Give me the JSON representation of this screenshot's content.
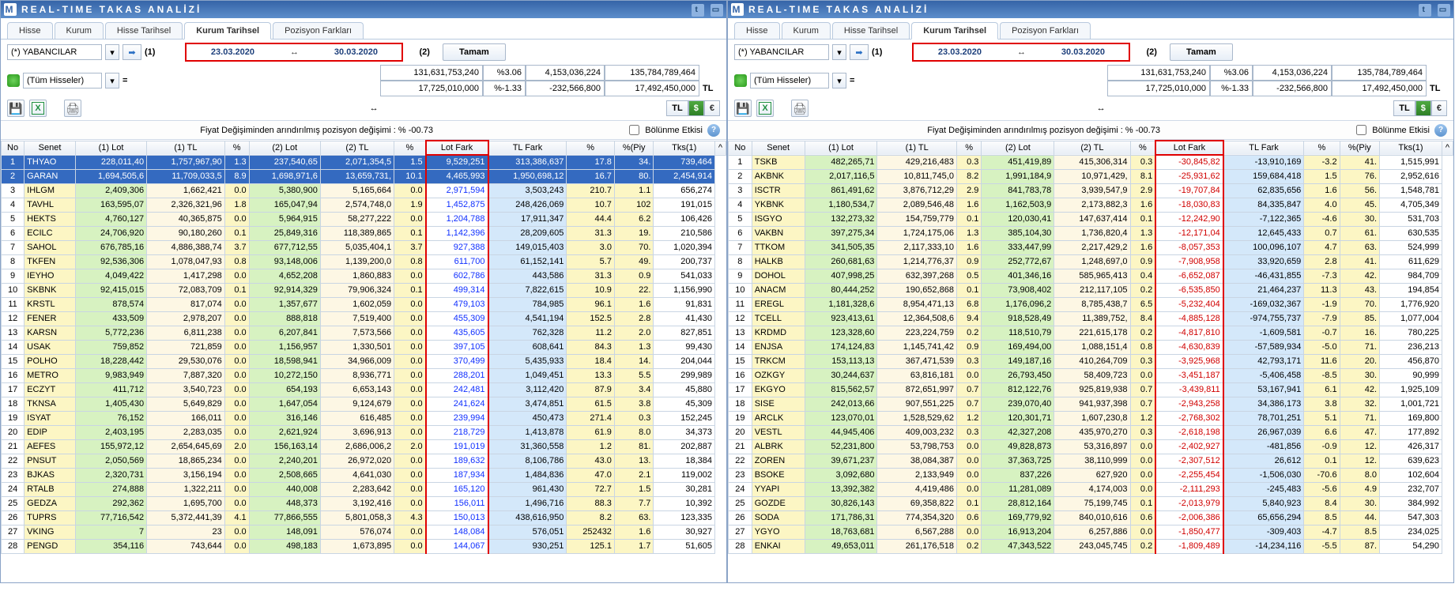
{
  "title": "REAL-TIME TAKAS ANALİZİ",
  "tabs": {
    "t0": "Hisse",
    "t1": "Kurum",
    "t2": "Hisse Tarihsel",
    "t3": "Kurum Tarihsel",
    "t4": "Pozisyon Farkları"
  },
  "filter": {
    "name": "(*) YABANCILAR",
    "all": "(Tüm Hisseler)",
    "l1": "(1)",
    "l2": "(2)",
    "tamam": "Tamam"
  },
  "dates": {
    "from": "23.03.2020",
    "to": "30.03.2020"
  },
  "summary": {
    "r1c1": "131,631,753,240",
    "r1c2": "%3.06",
    "r1c3": "4,153,036,224",
    "r1c4": "135,784,789,464",
    "r2c1": "17,725,010,000",
    "r2c2": "%-1.33",
    "r2c3": "-232,566,800",
    "r2c4": "17,492,450,000",
    "r2c5": "TL"
  },
  "tl": "TL",
  "usd": "$",
  "eur": "€",
  "arrow": "↔",
  "info": "Fiyat Değişiminden arındırılmış pozisyon değişimi : % -00.73",
  "chk": "Bölünme Etkisi",
  "hdr": {
    "no": "No",
    "senet": "Senet",
    "lot1": "(1) Lot",
    "tl1": "(1) TL",
    "p1": "%",
    "lot2": "(2) Lot",
    "tl2": "(2) TL",
    "p2": "%",
    "lotfark": "Lot Fark",
    "tlfark": "TL Fark",
    "p3": "%",
    "piy": "%(Piy",
    "tks": "Tks(1)"
  },
  "left": {
    "rows": [
      {
        "no": 1,
        "s": "THYAO",
        "l1": "228,011,40",
        "t1": "1,757,967,90",
        "p1": "1.3",
        "l2": "237,540,65",
        "t2": "2,071,354,5",
        "p2": "1.5",
        "lf": "9,529,251",
        "tf": "313,386,637",
        "p3": "17.8",
        "py": "34.",
        "tk": "739,464"
      },
      {
        "no": 2,
        "s": "GARAN",
        "l1": "1,694,505,6",
        "t1": "11,709,033,5",
        "p1": "8.9",
        "l2": "1,698,971,6",
        "t2": "13,659,731,",
        "p2": "10.1",
        "lf": "4,465,993",
        "tf": "1,950,698,12",
        "p3": "16.7",
        "py": "80.",
        "tk": "2,454,914"
      },
      {
        "no": 3,
        "s": "IHLGM",
        "l1": "2,409,306",
        "t1": "1,662,421",
        "p1": "0.0",
        "l2": "5,380,900",
        "t2": "5,165,664",
        "p2": "0.0",
        "lf": "2,971,594",
        "tf": "3,503,243",
        "p3": "210.7",
        "py": "1.1",
        "tk": "656,274"
      },
      {
        "no": 4,
        "s": "TAVHL",
        "l1": "163,595,07",
        "t1": "2,326,321,96",
        "p1": "1.8",
        "l2": "165,047,94",
        "t2": "2,574,748,0",
        "p2": "1.9",
        "lf": "1,452,875",
        "tf": "248,426,069",
        "p3": "10.7",
        "py": "102",
        "tk": "191,015"
      },
      {
        "no": 5,
        "s": "HEKTS",
        "l1": "4,760,127",
        "t1": "40,365,875",
        "p1": "0.0",
        "l2": "5,964,915",
        "t2": "58,277,222",
        "p2": "0.0",
        "lf": "1,204,788",
        "tf": "17,911,347",
        "p3": "44.4",
        "py": "6.2",
        "tk": "106,426"
      },
      {
        "no": 6,
        "s": "ECILC",
        "l1": "24,706,920",
        "t1": "90,180,260",
        "p1": "0.1",
        "l2": "25,849,316",
        "t2": "118,389,865",
        "p2": "0.1",
        "lf": "1,142,396",
        "tf": "28,209,605",
        "p3": "31.3",
        "py": "19.",
        "tk": "210,586"
      },
      {
        "no": 7,
        "s": "SAHOL",
        "l1": "676,785,16",
        "t1": "4,886,388,74",
        "p1": "3.7",
        "l2": "677,712,55",
        "t2": "5,035,404,1",
        "p2": "3.7",
        "lf": "927,388",
        "tf": "149,015,403",
        "p3": "3.0",
        "py": "70.",
        "tk": "1,020,394"
      },
      {
        "no": 8,
        "s": "TKFEN",
        "l1": "92,536,306",
        "t1": "1,078,047,93",
        "p1": "0.8",
        "l2": "93,148,006",
        "t2": "1,139,200,0",
        "p2": "0.8",
        "lf": "611,700",
        "tf": "61,152,141",
        "p3": "5.7",
        "py": "49.",
        "tk": "200,737"
      },
      {
        "no": 9,
        "s": "IEYHO",
        "l1": "4,049,422",
        "t1": "1,417,298",
        "p1": "0.0",
        "l2": "4,652,208",
        "t2": "1,860,883",
        "p2": "0.0",
        "lf": "602,786",
        "tf": "443,586",
        "p3": "31.3",
        "py": "0.9",
        "tk": "541,033"
      },
      {
        "no": 10,
        "s": "SKBNK",
        "l1": "92,415,015",
        "t1": "72,083,709",
        "p1": "0.1",
        "l2": "92,914,329",
        "t2": "79,906,324",
        "p2": "0.1",
        "lf": "499,314",
        "tf": "7,822,615",
        "p3": "10.9",
        "py": "22.",
        "tk": "1,156,990"
      },
      {
        "no": 11,
        "s": "KRSTL",
        "l1": "878,574",
        "t1": "817,074",
        "p1": "0.0",
        "l2": "1,357,677",
        "t2": "1,602,059",
        "p2": "0.0",
        "lf": "479,103",
        "tf": "784,985",
        "p3": "96.1",
        "py": "1.6",
        "tk": "91,831"
      },
      {
        "no": 12,
        "s": "FENER",
        "l1": "433,509",
        "t1": "2,978,207",
        "p1": "0.0",
        "l2": "888,818",
        "t2": "7,519,400",
        "p2": "0.0",
        "lf": "455,309",
        "tf": "4,541,194",
        "p3": "152.5",
        "py": "2.8",
        "tk": "41,430"
      },
      {
        "no": 13,
        "s": "KARSN",
        "l1": "5,772,236",
        "t1": "6,811,238",
        "p1": "0.0",
        "l2": "6,207,841",
        "t2": "7,573,566",
        "p2": "0.0",
        "lf": "435,605",
        "tf": "762,328",
        "p3": "11.2",
        "py": "2.0",
        "tk": "827,851"
      },
      {
        "no": 14,
        "s": "USAK",
        "l1": "759,852",
        "t1": "721,859",
        "p1": "0.0",
        "l2": "1,156,957",
        "t2": "1,330,501",
        "p2": "0.0",
        "lf": "397,105",
        "tf": "608,641",
        "p3": "84.3",
        "py": "1.3",
        "tk": "99,430"
      },
      {
        "no": 15,
        "s": "POLHO",
        "l1": "18,228,442",
        "t1": "29,530,076",
        "p1": "0.0",
        "l2": "18,598,941",
        "t2": "34,966,009",
        "p2": "0.0",
        "lf": "370,499",
        "tf": "5,435,933",
        "p3": "18.4",
        "py": "14.",
        "tk": "204,044"
      },
      {
        "no": 16,
        "s": "METRO",
        "l1": "9,983,949",
        "t1": "7,887,320",
        "p1": "0.0",
        "l2": "10,272,150",
        "t2": "8,936,771",
        "p2": "0.0",
        "lf": "288,201",
        "tf": "1,049,451",
        "p3": "13.3",
        "py": "5.5",
        "tk": "299,989"
      },
      {
        "no": 17,
        "s": "ECZYT",
        "l1": "411,712",
        "t1": "3,540,723",
        "p1": "0.0",
        "l2": "654,193",
        "t2": "6,653,143",
        "p2": "0.0",
        "lf": "242,481",
        "tf": "3,112,420",
        "p3": "87.9",
        "py": "3.4",
        "tk": "45,880"
      },
      {
        "no": 18,
        "s": "TKNSA",
        "l1": "1,405,430",
        "t1": "5,649,829",
        "p1": "0.0",
        "l2": "1,647,054",
        "t2": "9,124,679",
        "p2": "0.0",
        "lf": "241,624",
        "tf": "3,474,851",
        "p3": "61.5",
        "py": "3.8",
        "tk": "45,309"
      },
      {
        "no": 19,
        "s": "ISYAT",
        "l1": "76,152",
        "t1": "166,011",
        "p1": "0.0",
        "l2": "316,146",
        "t2": "616,485",
        "p2": "0.0",
        "lf": "239,994",
        "tf": "450,473",
        "p3": "271.4",
        "py": "0.3",
        "tk": "152,245"
      },
      {
        "no": 20,
        "s": "EDIP",
        "l1": "2,403,195",
        "t1": "2,283,035",
        "p1": "0.0",
        "l2": "2,621,924",
        "t2": "3,696,913",
        "p2": "0.0",
        "lf": "218,729",
        "tf": "1,413,878",
        "p3": "61.9",
        "py": "8.0",
        "tk": "34,373"
      },
      {
        "no": 21,
        "s": "AEFES",
        "l1": "155,972,12",
        "t1": "2,654,645,69",
        "p1": "2.0",
        "l2": "156,163,14",
        "t2": "2,686,006,2",
        "p2": "2.0",
        "lf": "191,019",
        "tf": "31,360,558",
        "p3": "1.2",
        "py": "81.",
        "tk": "202,887"
      },
      {
        "no": 22,
        "s": "PNSUT",
        "l1": "2,050,569",
        "t1": "18,865,234",
        "p1": "0.0",
        "l2": "2,240,201",
        "t2": "26,972,020",
        "p2": "0.0",
        "lf": "189,632",
        "tf": "8,106,786",
        "p3": "43.0",
        "py": "13.",
        "tk": "18,384"
      },
      {
        "no": 23,
        "s": "BJKAS",
        "l1": "2,320,731",
        "t1": "3,156,194",
        "p1": "0.0",
        "l2": "2,508,665",
        "t2": "4,641,030",
        "p2": "0.0",
        "lf": "187,934",
        "tf": "1,484,836",
        "p3": "47.0",
        "py": "2.1",
        "tk": "119,002"
      },
      {
        "no": 24,
        "s": "RTALB",
        "l1": "274,888",
        "t1": "1,322,211",
        "p1": "0.0",
        "l2": "440,008",
        "t2": "2,283,642",
        "p2": "0.0",
        "lf": "165,120",
        "tf": "961,430",
        "p3": "72.7",
        "py": "1.5",
        "tk": "30,281"
      },
      {
        "no": 25,
        "s": "GEDZA",
        "l1": "292,362",
        "t1": "1,695,700",
        "p1": "0.0",
        "l2": "448,373",
        "t2": "3,192,416",
        "p2": "0.0",
        "lf": "156,011",
        "tf": "1,496,716",
        "p3": "88.3",
        "py": "7.7",
        "tk": "10,392"
      },
      {
        "no": 26,
        "s": "TUPRS",
        "l1": "77,716,542",
        "t1": "5,372,441,39",
        "p1": "4.1",
        "l2": "77,866,555",
        "t2": "5,801,058,3",
        "p2": "4.3",
        "lf": "150,013",
        "tf": "438,616,950",
        "p3": "8.2",
        "py": "63.",
        "tk": "123,335"
      },
      {
        "no": 27,
        "s": "VKING",
        "l1": "7",
        "t1": "23",
        "p1": "0.0",
        "l2": "148,091",
        "t2": "576,074",
        "p2": "0.0",
        "lf": "148,084",
        "tf": "576,051",
        "p3": "252432",
        "py": "1.6",
        "tk": "30,927"
      },
      {
        "no": 28,
        "s": "PENGD",
        "l1": "354,116",
        "t1": "743,644",
        "p1": "0.0",
        "l2": "498,183",
        "t2": "1,673,895",
        "p2": "0.0",
        "lf": "144,067",
        "tf": "930,251",
        "p3": "125.1",
        "py": "1.7",
        "tk": "51,605"
      }
    ]
  },
  "right": {
    "rows": [
      {
        "no": 1,
        "s": "TSKB",
        "l1": "482,265,71",
        "t1": "429,216,483",
        "p1": "0.3",
        "l2": "451,419,89",
        "t2": "415,306,314",
        "p2": "0.3",
        "lf": "-30,845,82",
        "tf": "-13,910,169",
        "p3": "-3.2",
        "py": "41.",
        "tk": "1,515,991"
      },
      {
        "no": 2,
        "s": "AKBNK",
        "l1": "2,017,116,5",
        "t1": "10,811,745,0",
        "p1": "8.2",
        "l2": "1,991,184,9",
        "t2": "10,971,429,",
        "p2": "8.1",
        "lf": "-25,931,62",
        "tf": "159,684,418",
        "p3": "1.5",
        "py": "76.",
        "tk": "2,952,616"
      },
      {
        "no": 3,
        "s": "ISCTR",
        "l1": "861,491,62",
        "t1": "3,876,712,29",
        "p1": "2.9",
        "l2": "841,783,78",
        "t2": "3,939,547,9",
        "p2": "2.9",
        "lf": "-19,707,84",
        "tf": "62,835,656",
        "p3": "1.6",
        "py": "56.",
        "tk": "1,548,781"
      },
      {
        "no": 4,
        "s": "YKBNK",
        "l1": "1,180,534,7",
        "t1": "2,089,546,48",
        "p1": "1.6",
        "l2": "1,162,503,9",
        "t2": "2,173,882,3",
        "p2": "1.6",
        "lf": "-18,030,83",
        "tf": "84,335,847",
        "p3": "4.0",
        "py": "45.",
        "tk": "4,705,349"
      },
      {
        "no": 5,
        "s": "ISGYO",
        "l1": "132,273,32",
        "t1": "154,759,779",
        "p1": "0.1",
        "l2": "120,030,41",
        "t2": "147,637,414",
        "p2": "0.1",
        "lf": "-12,242,90",
        "tf": "-7,122,365",
        "p3": "-4.6",
        "py": "30.",
        "tk": "531,703"
      },
      {
        "no": 6,
        "s": "VAKBN",
        "l1": "397,275,34",
        "t1": "1,724,175,06",
        "p1": "1.3",
        "l2": "385,104,30",
        "t2": "1,736,820,4",
        "p2": "1.3",
        "lf": "-12,171,04",
        "tf": "12,645,433",
        "p3": "0.7",
        "py": "61.",
        "tk": "630,535"
      },
      {
        "no": 7,
        "s": "TTKOM",
        "l1": "341,505,35",
        "t1": "2,117,333,10",
        "p1": "1.6",
        "l2": "333,447,99",
        "t2": "2,217,429,2",
        "p2": "1.6",
        "lf": "-8,057,353",
        "tf": "100,096,107",
        "p3": "4.7",
        "py": "63.",
        "tk": "524,999"
      },
      {
        "no": 8,
        "s": "HALKB",
        "l1": "260,681,63",
        "t1": "1,214,776,37",
        "p1": "0.9",
        "l2": "252,772,67",
        "t2": "1,248,697,0",
        "p2": "0.9",
        "lf": "-7,908,958",
        "tf": "33,920,659",
        "p3": "2.8",
        "py": "41.",
        "tk": "611,629"
      },
      {
        "no": 9,
        "s": "DOHOL",
        "l1": "407,998,25",
        "t1": "632,397,268",
        "p1": "0.5",
        "l2": "401,346,16",
        "t2": "585,965,413",
        "p2": "0.4",
        "lf": "-6,652,087",
        "tf": "-46,431,855",
        "p3": "-7.3",
        "py": "42.",
        "tk": "984,709"
      },
      {
        "no": 10,
        "s": "ANACM",
        "l1": "80,444,252",
        "t1": "190,652,868",
        "p1": "0.1",
        "l2": "73,908,402",
        "t2": "212,117,105",
        "p2": "0.2",
        "lf": "-6,535,850",
        "tf": "21,464,237",
        "p3": "11.3",
        "py": "43.",
        "tk": "194,854"
      },
      {
        "no": 11,
        "s": "EREGL",
        "l1": "1,181,328,6",
        "t1": "8,954,471,13",
        "p1": "6.8",
        "l2": "1,176,096,2",
        "t2": "8,785,438,7",
        "p2": "6.5",
        "lf": "-5,232,404",
        "tf": "-169,032,367",
        "p3": "-1.9",
        "py": "70.",
        "tk": "1,776,920"
      },
      {
        "no": 12,
        "s": "TCELL",
        "l1": "923,413,61",
        "t1": "12,364,508,6",
        "p1": "9.4",
        "l2": "918,528,49",
        "t2": "11,389,752,",
        "p2": "8.4",
        "lf": "-4,885,128",
        "tf": "-974,755,737",
        "p3": "-7.9",
        "py": "85.",
        "tk": "1,077,004"
      },
      {
        "no": 13,
        "s": "KRDMD",
        "l1": "123,328,60",
        "t1": "223,224,759",
        "p1": "0.2",
        "l2": "118,510,79",
        "t2": "221,615,178",
        "p2": "0.2",
        "lf": "-4,817,810",
        "tf": "-1,609,581",
        "p3": "-0.7",
        "py": "16.",
        "tk": "780,225"
      },
      {
        "no": 14,
        "s": "ENJSA",
        "l1": "174,124,83",
        "t1": "1,145,741,42",
        "p1": "0.9",
        "l2": "169,494,00",
        "t2": "1,088,151,4",
        "p2": "0.8",
        "lf": "-4,630,839",
        "tf": "-57,589,934",
        "p3": "-5.0",
        "py": "71.",
        "tk": "236,213"
      },
      {
        "no": 15,
        "s": "TRKCM",
        "l1": "153,113,13",
        "t1": "367,471,539",
        "p1": "0.3",
        "l2": "149,187,16",
        "t2": "410,264,709",
        "p2": "0.3",
        "lf": "-3,925,968",
        "tf": "42,793,171",
        "p3": "11.6",
        "py": "20.",
        "tk": "456,870"
      },
      {
        "no": 16,
        "s": "OZKGY",
        "l1": "30,244,637",
        "t1": "63,816,181",
        "p1": "0.0",
        "l2": "26,793,450",
        "t2": "58,409,723",
        "p2": "0.0",
        "lf": "-3,451,187",
        "tf": "-5,406,458",
        "p3": "-8.5",
        "py": "30.",
        "tk": "90,999"
      },
      {
        "no": 17,
        "s": "EKGYO",
        "l1": "815,562,57",
        "t1": "872,651,997",
        "p1": "0.7",
        "l2": "812,122,76",
        "t2": "925,819,938",
        "p2": "0.7",
        "lf": "-3,439,811",
        "tf": "53,167,941",
        "p3": "6.1",
        "py": "42.",
        "tk": "1,925,109"
      },
      {
        "no": 18,
        "s": "SISE",
        "l1": "242,013,66",
        "t1": "907,551,225",
        "p1": "0.7",
        "l2": "239,070,40",
        "t2": "941,937,398",
        "p2": "0.7",
        "lf": "-2,943,258",
        "tf": "34,386,173",
        "p3": "3.8",
        "py": "32.",
        "tk": "1,001,721"
      },
      {
        "no": 19,
        "s": "ARCLK",
        "l1": "123,070,01",
        "t1": "1,528,529,62",
        "p1": "1.2",
        "l2": "120,301,71",
        "t2": "1,607,230,8",
        "p2": "1.2",
        "lf": "-2,768,302",
        "tf": "78,701,251",
        "p3": "5.1",
        "py": "71.",
        "tk": "169,800"
      },
      {
        "no": 20,
        "s": "VESTL",
        "l1": "44,945,406",
        "t1": "409,003,232",
        "p1": "0.3",
        "l2": "42,327,208",
        "t2": "435,970,270",
        "p2": "0.3",
        "lf": "-2,618,198",
        "tf": "26,967,039",
        "p3": "6.6",
        "py": "47.",
        "tk": "177,892"
      },
      {
        "no": 21,
        "s": "ALBRK",
        "l1": "52,231,800",
        "t1": "53,798,753",
        "p1": "0.0",
        "l2": "49,828,873",
        "t2": "53,316,897",
        "p2": "0.0",
        "lf": "-2,402,927",
        "tf": "-481,856",
        "p3": "-0.9",
        "py": "12.",
        "tk": "426,317"
      },
      {
        "no": 22,
        "s": "ZOREN",
        "l1": "39,671,237",
        "t1": "38,084,387",
        "p1": "0.0",
        "l2": "37,363,725",
        "t2": "38,110,999",
        "p2": "0.0",
        "lf": "-2,307,512",
        "tf": "26,612",
        "p3": "0.1",
        "py": "12.",
        "tk": "639,623"
      },
      {
        "no": 23,
        "s": "BSOKE",
        "l1": "3,092,680",
        "t1": "2,133,949",
        "p1": "0.0",
        "l2": "837,226",
        "t2": "627,920",
        "p2": "0.0",
        "lf": "-2,255,454",
        "tf": "-1,506,030",
        "p3": "-70.6",
        "py": "8.0",
        "tk": "102,604"
      },
      {
        "no": 24,
        "s": "YYAPI",
        "l1": "13,392,382",
        "t1": "4,419,486",
        "p1": "0.0",
        "l2": "11,281,089",
        "t2": "4,174,003",
        "p2": "0.0",
        "lf": "-2,111,293",
        "tf": "-245,483",
        "p3": "-5.6",
        "py": "4.9",
        "tk": "232,707"
      },
      {
        "no": 25,
        "s": "GOZDE",
        "l1": "30,826,143",
        "t1": "69,358,822",
        "p1": "0.1",
        "l2": "28,812,164",
        "t2": "75,199,745",
        "p2": "0.1",
        "lf": "-2,013,979",
        "tf": "5,840,923",
        "p3": "8.4",
        "py": "30.",
        "tk": "384,992"
      },
      {
        "no": 26,
        "s": "SODA",
        "l1": "171,786,31",
        "t1": "774,354,320",
        "p1": "0.6",
        "l2": "169,779,92",
        "t2": "840,010,616",
        "p2": "0.6",
        "lf": "-2,006,386",
        "tf": "65,656,294",
        "p3": "8.5",
        "py": "44.",
        "tk": "547,303"
      },
      {
        "no": 27,
        "s": "YGYO",
        "l1": "18,763,681",
        "t1": "6,567,288",
        "p1": "0.0",
        "l2": "16,913,204",
        "t2": "6,257,886",
        "p2": "0.0",
        "lf": "-1,850,477",
        "tf": "-309,403",
        "p3": "-4.7",
        "py": "8.5",
        "tk": "234,025"
      },
      {
        "no": 28,
        "s": "ENKAI",
        "l1": "49,653,011",
        "t1": "261,176,518",
        "p1": "0.2",
        "l2": "47,343,522",
        "t2": "243,045,745",
        "p2": "0.2",
        "lf": "-1,809,489",
        "tf": "-14,234,116",
        "p3": "-5.5",
        "py": "87.",
        "tk": "54,290"
      }
    ]
  }
}
